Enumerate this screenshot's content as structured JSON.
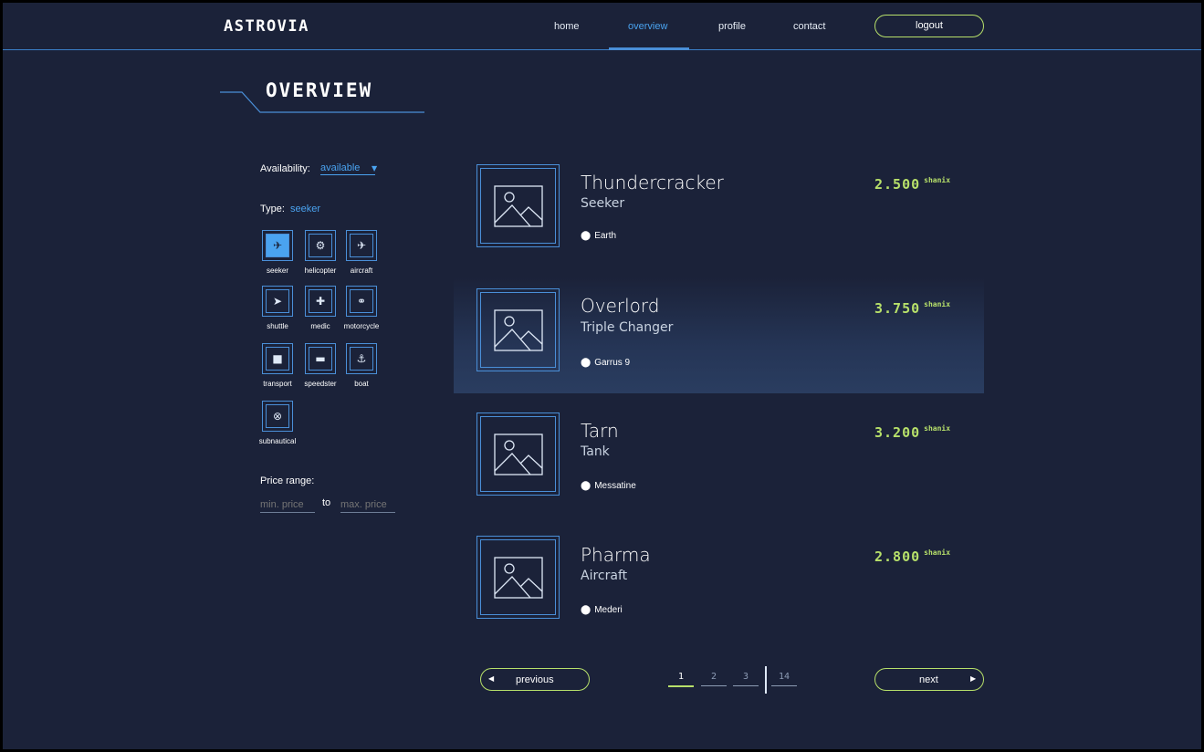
{
  "header": {
    "logo": "ASTROVIA",
    "nav": [
      "home",
      "overview",
      "profile",
      "contact"
    ],
    "active_nav": "overview",
    "logout": "logout"
  },
  "page_title": "OVERVIEW",
  "filters": {
    "availability_label": "Availability:",
    "availability_value": "available",
    "type_label": "Type:",
    "type_value": "seeker",
    "types": [
      {
        "label": "seeker",
        "icon": "jet-icon",
        "selected": true
      },
      {
        "label": "helicopter",
        "icon": "helicopter-icon",
        "selected": false
      },
      {
        "label": "aircraft",
        "icon": "plane-icon",
        "selected": false
      },
      {
        "label": "shuttle",
        "icon": "shuttle-icon",
        "selected": false
      },
      {
        "label": "medic",
        "icon": "ambulance-icon",
        "selected": false
      },
      {
        "label": "motorcycle",
        "icon": "motorcycle-icon",
        "selected": false
      },
      {
        "label": "transport",
        "icon": "truck-icon",
        "selected": false
      },
      {
        "label": "speedster",
        "icon": "car-icon",
        "selected": false
      },
      {
        "label": "boat",
        "icon": "anchor-icon",
        "selected": false
      },
      {
        "label": "subnautical",
        "icon": "lifebuoy-icon",
        "selected": false
      }
    ],
    "price_label": "Price range:",
    "min_placeholder": "min. price",
    "to": "to",
    "max_placeholder": "max. price"
  },
  "listings": [
    {
      "name": "Thundercracker",
      "type": "Seeker",
      "location": "Earth",
      "price": "2.500",
      "unit": "shanix",
      "highlighted": false
    },
    {
      "name": "Overlord",
      "type": "Triple Changer",
      "location": "Garrus 9",
      "price": "3.750",
      "unit": "shanix",
      "highlighted": true
    },
    {
      "name": "Tarn",
      "type": "Tank",
      "location": "Messatine",
      "price": "3.200",
      "unit": "shanix",
      "highlighted": false
    },
    {
      "name": "Pharma",
      "type": "Aircraft",
      "location": "Mederi",
      "price": "2.800",
      "unit": "shanix",
      "highlighted": false
    }
  ],
  "pagination": {
    "previous": "previous",
    "next": "next",
    "pages": [
      "1",
      "2",
      "3"
    ],
    "last": "14",
    "current": "1"
  },
  "colors": {
    "background": "#1b2239",
    "accent_blue": "#4aa3f0",
    "accent_green": "#b7e06a"
  }
}
